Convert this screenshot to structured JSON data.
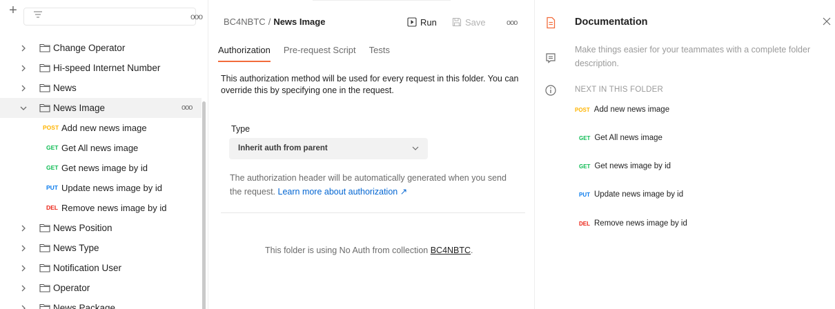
{
  "sidebar": {
    "filter_placeholder": "",
    "folders_before": [
      {
        "label": "Change Operator"
      },
      {
        "label": "Hi-speed Internet Number"
      },
      {
        "label": "News"
      }
    ],
    "selected_folder": {
      "label": "News Image"
    },
    "requests": [
      {
        "method": "POST",
        "label": "Add new news image",
        "color": "#ffb400"
      },
      {
        "method": "GET",
        "label": "Get All news image",
        "color": "#0cbb52"
      },
      {
        "method": "GET",
        "label": "Get news image by id",
        "color": "#0cbb52"
      },
      {
        "method": "PUT",
        "label": "Update news image by id",
        "color": "#097bed"
      },
      {
        "method": "DEL",
        "label": "Remove news image by id",
        "color": "#eb2013"
      }
    ],
    "folders_after": [
      {
        "label": "News Position"
      },
      {
        "label": "News Type"
      },
      {
        "label": "Notification User"
      },
      {
        "label": "Operator"
      },
      {
        "label": "News Package"
      }
    ]
  },
  "main": {
    "breadcrumb": {
      "parent": "BC4NBTC",
      "separator": "/",
      "current": "News Image"
    },
    "run_label": "Run",
    "save_label": "Save",
    "tabs": [
      {
        "label": "Authorization",
        "active": true
      },
      {
        "label": "Pre-request Script",
        "active": false
      },
      {
        "label": "Tests",
        "active": false
      }
    ],
    "description": "This authorization method will be used for every request in this folder. You can override this by specifying one in the request.",
    "type_label": "Type",
    "type_value": "Inherit auth from parent",
    "auth_info_text": "The authorization header will be automatically generated when you send the request. ",
    "auth_info_link": "Learn more about authorization ↗",
    "no_auth_text": "This folder is using No Auth from collection ",
    "no_auth_collection": "BC4NBTC",
    "no_auth_end": "."
  },
  "documentation": {
    "title": "Documentation",
    "description": "Make things easier for your teammates with a complete folder description.",
    "next_heading": "NEXT IN THIS FOLDER",
    "items": [
      {
        "method": "POST",
        "label": "Add new news image",
        "color": "#ffb400"
      },
      {
        "method": "GET",
        "label": "Get All news image",
        "color": "#0cbb52"
      },
      {
        "method": "GET",
        "label": "Get news image by id",
        "color": "#0cbb52"
      },
      {
        "method": "PUT",
        "label": "Update news image by id",
        "color": "#097bed"
      },
      {
        "method": "DEL",
        "label": "Remove news image by id",
        "color": "#eb2013"
      }
    ]
  },
  "colors": {
    "accent": "#f26b3a",
    "link": "#0265d2"
  }
}
